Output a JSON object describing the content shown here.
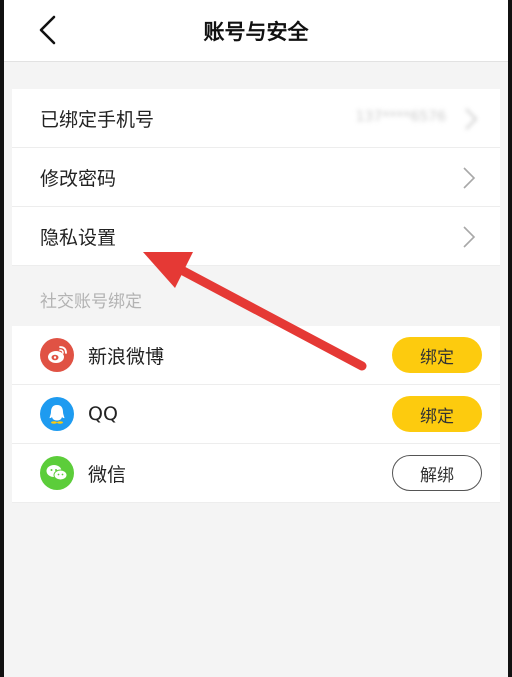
{
  "header": {
    "title": "账号与安全",
    "back_icon": "chevron-left-icon"
  },
  "settings": {
    "items": [
      {
        "label": "已绑定手机号",
        "value": "137****6576"
      },
      {
        "label": "修改密码"
      },
      {
        "label": "隐私设置"
      }
    ]
  },
  "social": {
    "section_label": "社交账号绑定",
    "items": [
      {
        "label": "新浪微博",
        "icon": "weibo-icon",
        "icon_color": "#e05244",
        "action": "绑定",
        "state": "unbound"
      },
      {
        "label": "QQ",
        "icon": "qq-icon",
        "icon_color": "#1e9bf0",
        "action": "绑定",
        "state": "unbound"
      },
      {
        "label": "微信",
        "icon": "wechat-icon",
        "icon_color": "#5ccd3a",
        "action": "解绑",
        "state": "bound"
      }
    ]
  },
  "colors": {
    "accent": "#fdcb0e",
    "annotation_arrow": "#e53935"
  }
}
